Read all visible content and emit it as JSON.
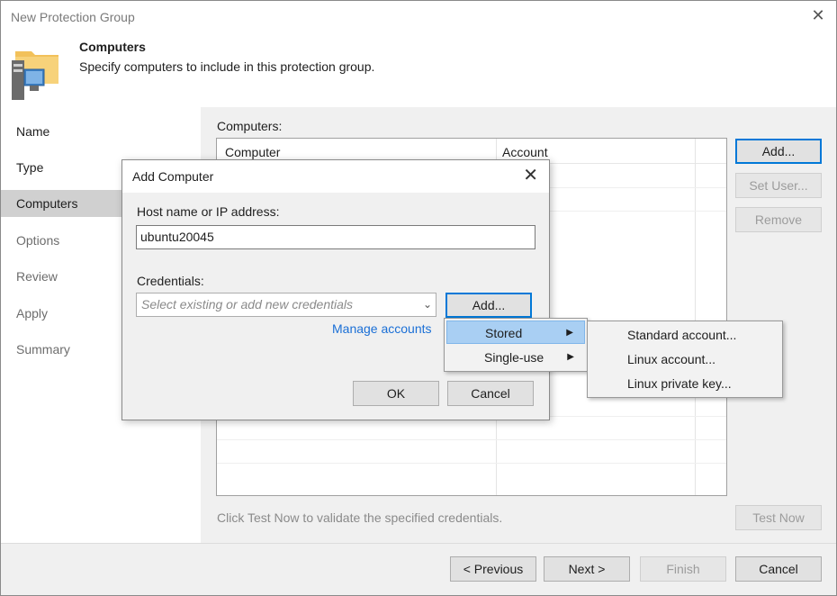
{
  "window": {
    "title": "New Protection Group",
    "close_glyph": "✕"
  },
  "header": {
    "title": "Computers",
    "subtitle": "Specify computers to include in this protection group.",
    "icon": "folder-computer-icon"
  },
  "sidebar": {
    "items": [
      {
        "label": "Name"
      },
      {
        "label": "Type"
      },
      {
        "label": "Computers"
      },
      {
        "label": "Options"
      },
      {
        "label": "Review"
      },
      {
        "label": "Apply"
      },
      {
        "label": "Summary"
      }
    ]
  },
  "main": {
    "computers_label": "Computers:",
    "columns": [
      "Computer",
      "Account"
    ],
    "add_label": "Add...",
    "set_user_label": "Set User...",
    "remove_label": "Remove",
    "hint": "Click Test Now to validate the specified credentials.",
    "test_now_label": "Test Now"
  },
  "footer": {
    "previous_label": "< Previous",
    "next_label": "Next >",
    "finish_label": "Finish",
    "cancel_label": "Cancel"
  },
  "dialog": {
    "title": "Add Computer",
    "close_glyph": "✕",
    "host_label": "Host name or IP address:",
    "host_value": "ubuntu20045",
    "credentials_label": "Credentials:",
    "credentials_placeholder": "Select existing or add new credentials",
    "add_label": "Add...",
    "manage_accounts_label": "Manage accounts",
    "ok_label": "OK",
    "cancel_label": "Cancel"
  },
  "add_menu": {
    "items": [
      {
        "label": "Stored"
      },
      {
        "label": "Single-use"
      }
    ]
  },
  "stored_submenu": {
    "items": [
      {
        "label": "Standard account..."
      },
      {
        "label": "Linux account..."
      },
      {
        "label": "Linux private key..."
      }
    ]
  }
}
